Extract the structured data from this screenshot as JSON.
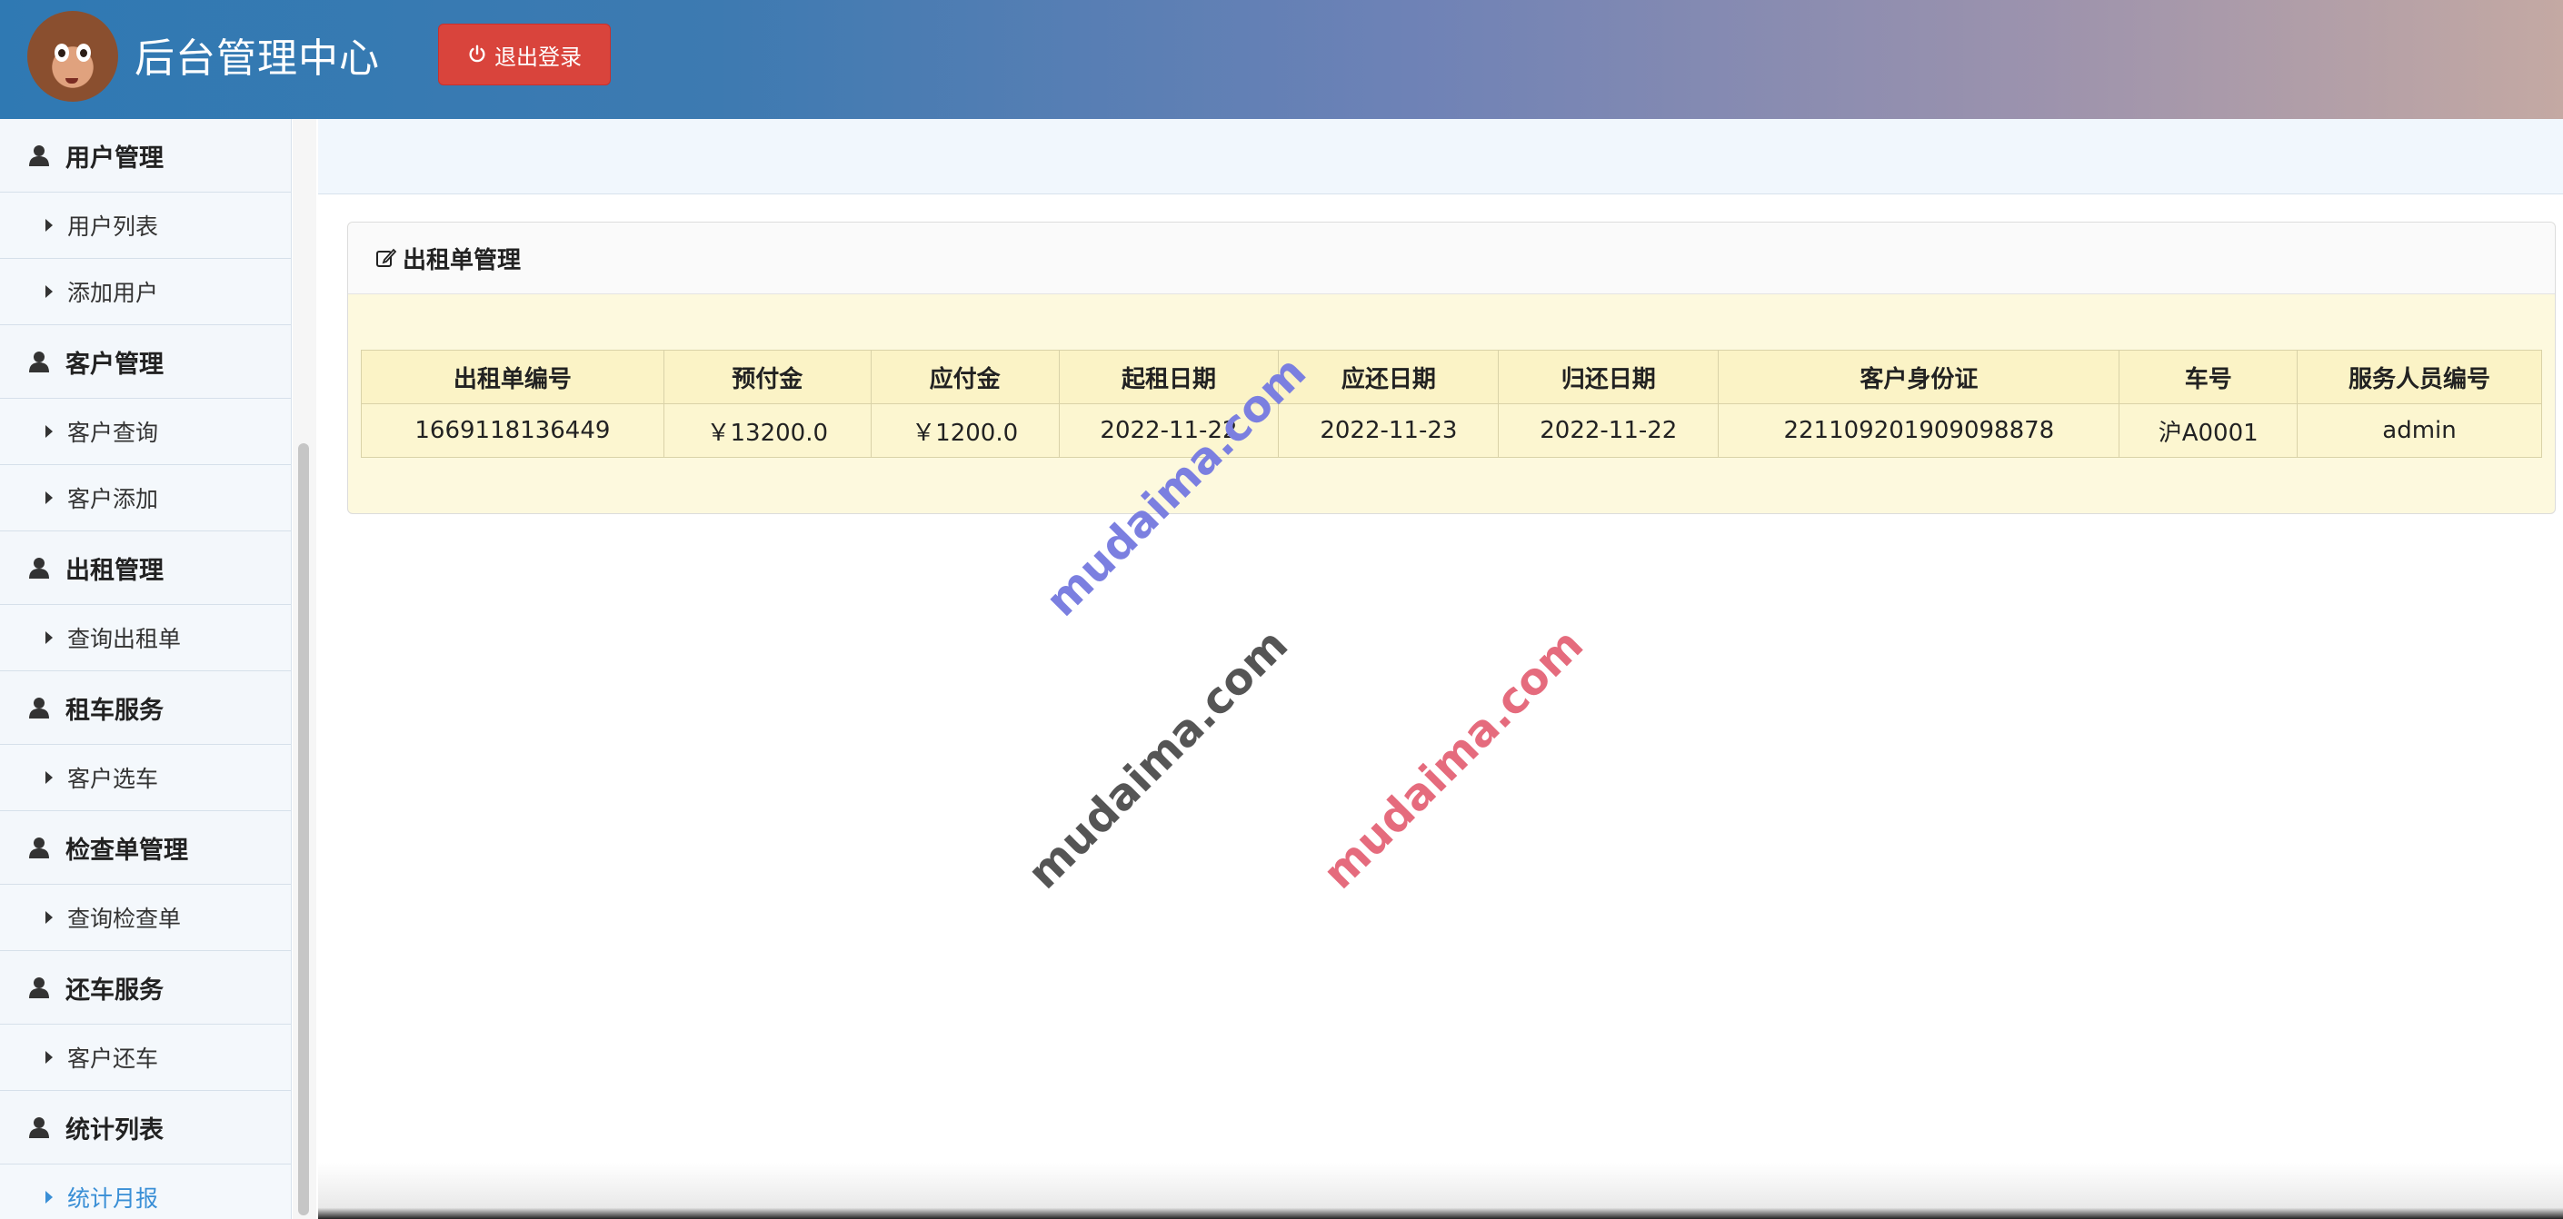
{
  "header": {
    "title": "后台管理中心",
    "logout_label": "退出登录",
    "colors": {
      "logout_bg": "#d9443c",
      "header_from": "#2f79b3",
      "header_to": "#c4a9a3"
    }
  },
  "sidebar": {
    "sections": [
      {
        "title": "用户管理",
        "items": [
          "用户列表",
          "添加用户"
        ]
      },
      {
        "title": "客户管理",
        "items": [
          "客户查询",
          "客户添加"
        ]
      },
      {
        "title": "出租管理",
        "items": [
          "查询出租单"
        ]
      },
      {
        "title": "租车服务",
        "items": [
          "客户选车"
        ]
      },
      {
        "title": "检查单管理",
        "items": [
          "查询检查单"
        ]
      },
      {
        "title": "还车服务",
        "items": [
          "客户还车"
        ]
      },
      {
        "title": "统计列表",
        "items": [
          "统计月报"
        ]
      }
    ],
    "active_item": "统计月报",
    "icon": "user-icon"
  },
  "panel": {
    "title": "出租单管理",
    "icon": "edit-icon",
    "columns": [
      "出租单编号",
      "预付金",
      "应付金",
      "起租日期",
      "应还日期",
      "归还日期",
      "客户身份证",
      "车号",
      "服务人员编号"
    ],
    "rows": [
      [
        "1669118136449",
        "￥13200.0",
        "￥1200.0",
        "2022-11-22",
        "2022-11-23",
        "2022-11-22",
        "221109201909098878",
        "沪A0001",
        "admin"
      ]
    ]
  },
  "watermarks": [
    "mudaima.com",
    "mudaima.com",
    "mudaima.com"
  ]
}
